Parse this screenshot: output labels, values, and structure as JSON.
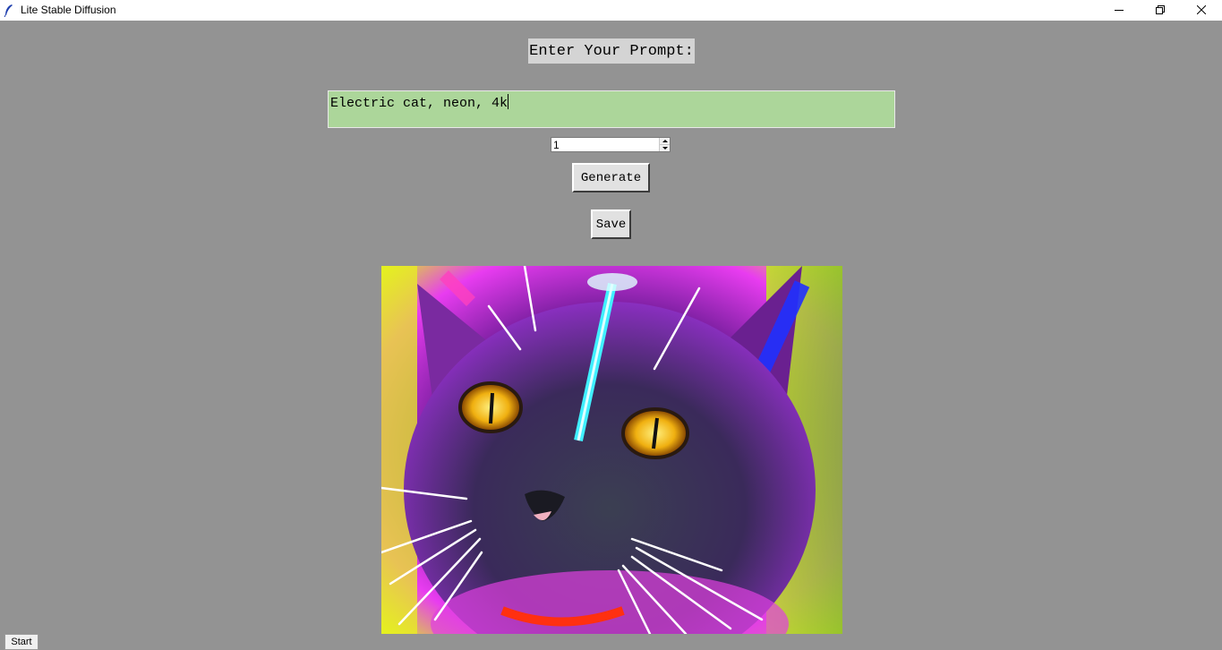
{
  "window": {
    "title": "Lite Stable Diffusion",
    "icon": "feather-icon"
  },
  "prompt": {
    "label": "Enter Your Prompt:",
    "value": "Electric cat, neon, 4k"
  },
  "count_spinbox": {
    "value": "1"
  },
  "buttons": {
    "generate": "Generate",
    "save": "Save",
    "start": "Start"
  },
  "image": {
    "subject": "neon electric cat portrait",
    "colors": {
      "magenta": "#e040fb",
      "yellow_glow": "#e8f020",
      "cyan": "#40f0ff",
      "blue": "#2030ff",
      "eye": "#f0c020"
    }
  },
  "colors": {
    "background": "#939393",
    "entry_bg": "#acd69a",
    "label_bg": "#d4d4d4"
  }
}
